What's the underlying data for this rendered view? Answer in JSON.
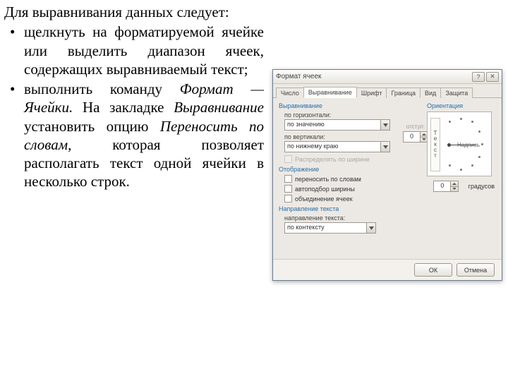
{
  "slide": {
    "intro": "Для выравнивания данных следует:",
    "b1_a": "щелкнуть на форматируемой ячейке или выделить диапазон ячеек, содержащих выравниваемый текст;",
    "b2_a": "выполнить команду ",
    "b2_b": "Формат —Ячейки.",
    "b2_c": " На закладке ",
    "b2_d": "Выравнивание",
    "b2_e": " установить опцию ",
    "b2_f": "Переносить по словам",
    "b2_g": ", которая позволяет располагать текст одной ячейки в несколько строк."
  },
  "dialog": {
    "title": "Формат ячеек",
    "help": "?",
    "close": "✕",
    "tabs": [
      "Число",
      "Выравнивание",
      "Шрифт",
      "Граница",
      "Вид",
      "Защита"
    ],
    "groups": {
      "align": "Выравнивание",
      "display": "Отображение",
      "direction": "Направление текста",
      "orient": "Ориентация"
    },
    "horiz_label": "по горизонтали:",
    "horiz_value": "по значению",
    "vert_label": "по вертикали:",
    "vert_value": "по нижнему краю",
    "indent_label": "отступ:",
    "indent_value": "0",
    "chk_distribute": "Распределять по ширине",
    "chk_wrap": "переносить по словам",
    "chk_autofit": "автоподбор ширины",
    "chk_merge": "объединение ячеек",
    "dir_label": "направление текста:",
    "dir_value": "по контексту",
    "orient_vert": "Текст",
    "orient_label": "Надпись",
    "deg_value": "0",
    "deg_label": "градусов",
    "ok": "ОК",
    "cancel": "Отмена"
  }
}
